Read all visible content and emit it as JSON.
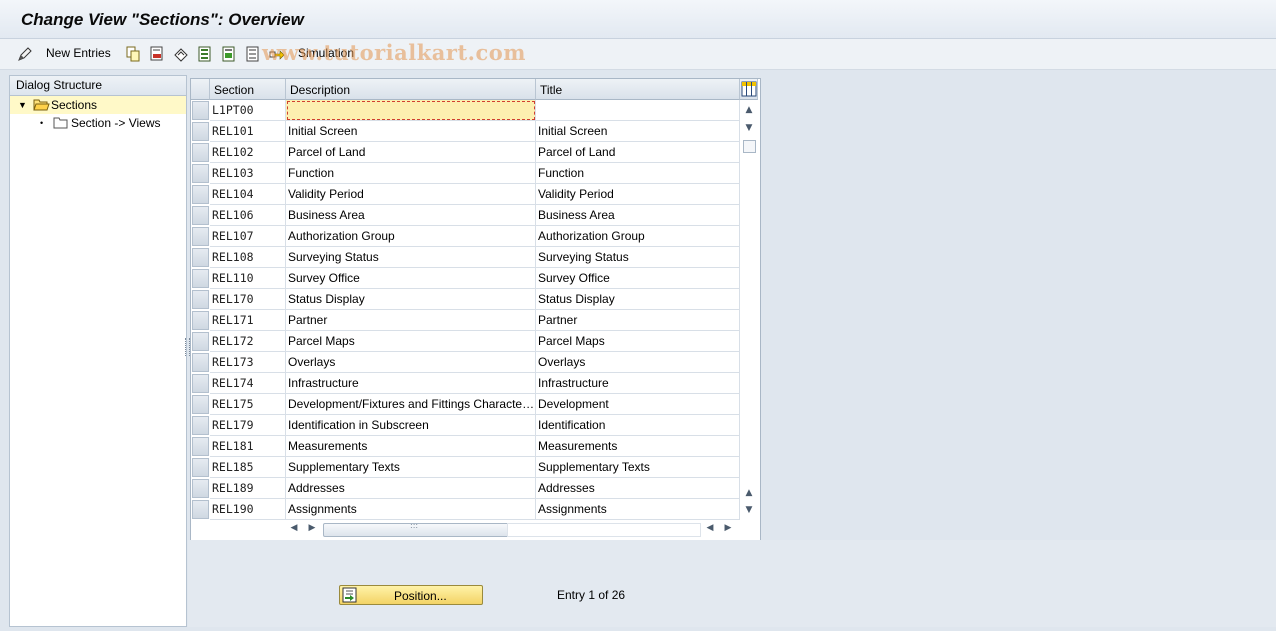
{
  "window": {
    "title": "Change View \"Sections\": Overview"
  },
  "toolbar": {
    "new_entries_label": "New Entries",
    "simulation_label": "Simulation",
    "icons": [
      "edit-icon",
      "copy-icon",
      "delete-icon",
      "undo-icon",
      "select-all-icon",
      "select-block-icon",
      "deselect-all-icon",
      "transport-icon"
    ]
  },
  "watermark": "www.tutorialkart.com",
  "dialog_structure": {
    "header": "Dialog Structure",
    "items": [
      {
        "label": "Sections",
        "selected": true,
        "expanded": true
      },
      {
        "label": "Section -> Views",
        "selected": false
      }
    ]
  },
  "table": {
    "columns": [
      "Section",
      "Description",
      "Title"
    ],
    "rows": [
      {
        "section": "L1PT00",
        "description": "",
        "title": ""
      },
      {
        "section": "REL101",
        "description": "Initial Screen",
        "title": "Initial Screen"
      },
      {
        "section": "REL102",
        "description": "Parcel of Land",
        "title": "Parcel of Land"
      },
      {
        "section": "REL103",
        "description": "Function",
        "title": "Function"
      },
      {
        "section": "REL104",
        "description": "Validity Period",
        "title": "Validity Period"
      },
      {
        "section": "REL106",
        "description": "Business Area",
        "title": "Business Area"
      },
      {
        "section": "REL107",
        "description": "Authorization Group",
        "title": "Authorization Group"
      },
      {
        "section": "REL108",
        "description": "Surveying Status",
        "title": "Surveying Status"
      },
      {
        "section": "REL110",
        "description": "Survey Office",
        "title": "Survey Office"
      },
      {
        "section": "REL170",
        "description": "Status Display",
        "title": "Status Display"
      },
      {
        "section": "REL171",
        "description": "Partner",
        "title": "Partner"
      },
      {
        "section": "REL172",
        "description": "Parcel Maps",
        "title": "Parcel Maps"
      },
      {
        "section": "REL173",
        "description": "Overlays",
        "title": "Overlays"
      },
      {
        "section": "REL174",
        "description": "Infrastructure",
        "title": "Infrastructure"
      },
      {
        "section": "REL175",
        "description": "Development/Fixtures and Fittings Characteristics",
        "title": "Development"
      },
      {
        "section": "REL179",
        "description": "Identification in Subscreen",
        "title": "Identification"
      },
      {
        "section": "REL181",
        "description": "Measurements",
        "title": "Measurements"
      },
      {
        "section": "REL185",
        "description": "Supplementary Texts",
        "title": "Supplementary Texts"
      },
      {
        "section": "REL189",
        "description": "Addresses",
        "title": "Addresses"
      },
      {
        "section": "REL190",
        "description": "Assignments",
        "title": "Assignments"
      }
    ]
  },
  "footer": {
    "position_button": "Position...",
    "entry_info": "Entry 1 of 26"
  }
}
